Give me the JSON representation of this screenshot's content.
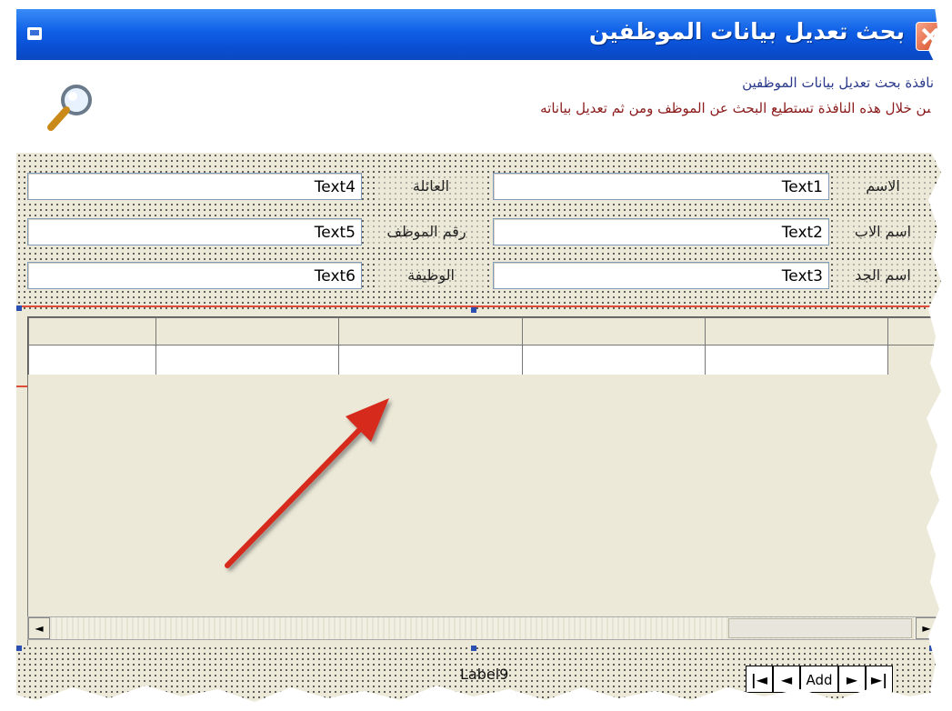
{
  "window": {
    "title": "بحث تعديل بيانات الموظفين"
  },
  "banner": {
    "title": "نافذة بحث تعديل بيانات الموظفين",
    "description": "من خلال هذه النافذة تستطيع البحث عن الموظف ومن ثم تعديل بياناته",
    "icon": "magnifier-icon"
  },
  "form": {
    "labels": {
      "name": "الاسم",
      "father": "اسم الاب",
      "grandfather": "اسم الجد",
      "family": "العائلة",
      "emp_no": "رقم الموظف",
      "job": "الوظيفة"
    },
    "fields": {
      "text1": "Text1",
      "text2": "Text2",
      "text3": "Text3",
      "text4": "Text4",
      "text5": "Text5",
      "text6": "Text6"
    }
  },
  "grid": {
    "column_count": 6
  },
  "scrollbar": {
    "left_arrow": "◄",
    "right_arrow": "►"
  },
  "footer": {
    "label": "Label9"
  },
  "navigator": {
    "first": "|◄",
    "prev": "◄",
    "add": "Add",
    "next": "►",
    "last": "►|"
  },
  "colors": {
    "titlebar": "#0f5fe6",
    "annotation_red": "#e04b3a",
    "form_bg": "#ece9d8"
  }
}
